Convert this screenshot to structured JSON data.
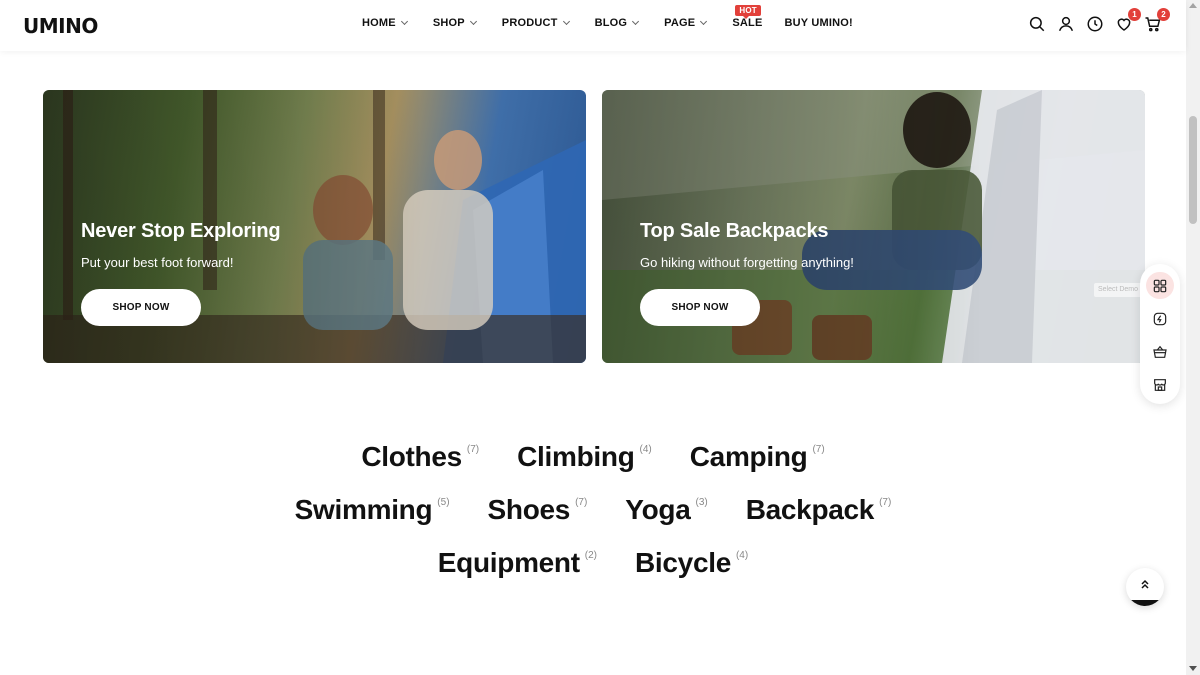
{
  "brand": {
    "logo": "UMINO"
  },
  "nav": {
    "items": [
      {
        "label": "HOME",
        "dropdown": true
      },
      {
        "label": "SHOP",
        "dropdown": true
      },
      {
        "label": "PRODUCT",
        "dropdown": true
      },
      {
        "label": "BLOG",
        "dropdown": true
      },
      {
        "label": "PAGE",
        "dropdown": true
      },
      {
        "label": "SALE",
        "dropdown": false,
        "badge": "HOT"
      },
      {
        "label": "BUY UMINO!",
        "dropdown": false
      }
    ]
  },
  "header_icons": {
    "search": "search-icon",
    "account": "user-icon",
    "recent": "clock-icon",
    "wishlist": {
      "icon": "heart-icon",
      "count": "1"
    },
    "cart": {
      "icon": "cart-icon",
      "count": "2"
    }
  },
  "banners": [
    {
      "title": "Never Stop Exploring",
      "subtitle": "Put your best foot forward!",
      "button": "SHOP NOW"
    },
    {
      "title": "Top Sale Backpacks",
      "subtitle": "Go hiking without forgetting anything!",
      "button": "SHOP NOW"
    }
  ],
  "categories": {
    "rows": [
      [
        {
          "name": "Clothes",
          "count": "(7)"
        },
        {
          "name": "Climbing",
          "count": "(4)"
        },
        {
          "name": "Camping",
          "count": "(7)"
        }
      ],
      [
        {
          "name": "Swimming",
          "count": "(5)"
        },
        {
          "name": "Shoes",
          "count": "(7)"
        },
        {
          "name": "Yoga",
          "count": "(3)"
        },
        {
          "name": "Backpack",
          "count": "(7)"
        }
      ],
      [
        {
          "name": "Equipment",
          "count": "(2)"
        },
        {
          "name": "Bicycle",
          "count": "(4)"
        }
      ]
    ]
  },
  "side_toolbar": {
    "tooltip": "Select Demo",
    "buttons": [
      "demos-icon",
      "buy-icon",
      "basket-icon",
      "store-icon"
    ]
  },
  "colors": {
    "accent": "#e2403a",
    "text": "#111111"
  }
}
